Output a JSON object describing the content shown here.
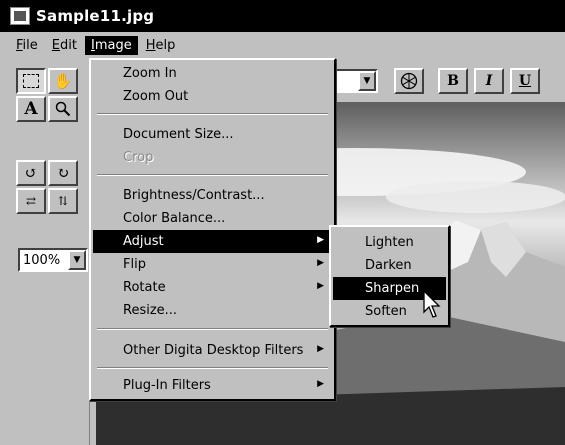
{
  "window": {
    "title": "Sample11.jpg"
  },
  "menubar": {
    "items": [
      {
        "label": "File",
        "key": "F",
        "rest": "ile"
      },
      {
        "label": "Edit",
        "key": "E",
        "rest": "dit"
      },
      {
        "label": "Image",
        "key": "I",
        "rest": "mage",
        "active": true
      },
      {
        "label": "Help",
        "key": "H",
        "rest": "elp"
      }
    ]
  },
  "toolbox": {
    "tools": [
      "select-marquee",
      "hand",
      "text",
      "zoom",
      "rotate-left",
      "rotate-right",
      "flip-horizontal",
      "flip-vertical"
    ],
    "text_tool_label": "A",
    "zoom_value": "100%"
  },
  "format_toolbar": {
    "bold_label": "B",
    "italic_label": "I",
    "underline_label": "U"
  },
  "image_menu": {
    "items": [
      {
        "label": "Zoom In"
      },
      {
        "label": "Zoom Out"
      },
      {
        "label": "Document Size..."
      },
      {
        "label": "Crop",
        "disabled": true
      },
      {
        "label": "Brightness/Contrast..."
      },
      {
        "label": "Color Balance..."
      },
      {
        "label": "Adjust",
        "submenu": true,
        "selected": true
      },
      {
        "label": "Flip",
        "submenu": true
      },
      {
        "label": "Rotate",
        "submenu": true
      },
      {
        "label": "Resize..."
      },
      {
        "label": "Other Digita Desktop Filters",
        "submenu": true
      },
      {
        "label": "Plug-In Filters",
        "submenu": true
      }
    ]
  },
  "adjust_submenu": {
    "items": [
      {
        "label": "Lighten"
      },
      {
        "label": "Darken"
      },
      {
        "label": "Sharpen",
        "selected": true
      },
      {
        "label": "Soften"
      }
    ]
  },
  "colors": {
    "selection": "#000000",
    "face": "#c0c0c0",
    "disabled_text": "#8c8c8c"
  }
}
